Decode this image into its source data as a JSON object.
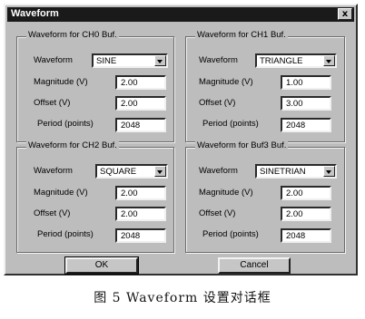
{
  "window": {
    "title": "Waveform",
    "close_label": "x"
  },
  "groups": [
    {
      "title": "Waveform for CH0 Buf.",
      "waveform_label": "Waveform",
      "waveform_value": "SINE",
      "magnitude_label": "Magnitude (V)",
      "magnitude_value": "2.00",
      "offset_label": "Offset (V)",
      "offset_value": "2.00",
      "period_label": "Period (points)",
      "period_value": "2048"
    },
    {
      "title": "Waveform for CH1 Buf.",
      "waveform_label": "Waveform",
      "waveform_value": "TRIANGLE",
      "magnitude_label": "Magnitude (V)",
      "magnitude_value": "1.00",
      "offset_label": "Offset (V)",
      "offset_value": "3.00",
      "period_label": "Period (points)",
      "period_value": "2048"
    },
    {
      "title": "Waveform for CH2 Buf.",
      "waveform_label": "Waveform",
      "waveform_value": "SQUARE",
      "magnitude_label": "Magnitude (V)",
      "magnitude_value": "2.00",
      "offset_label": "Offset (V)",
      "offset_value": "2.00",
      "period_label": "Period (points)",
      "period_value": "2048"
    },
    {
      "title": "Waveform for Buf3 Buf.",
      "waveform_label": "Waveform",
      "waveform_value": "SINETRIAN",
      "magnitude_label": "Magnitude (V)",
      "magnitude_value": "2.00",
      "offset_label": "Offset (V)",
      "offset_value": "2.00",
      "period_label": "Period (points)",
      "period_value": "2048"
    }
  ],
  "buttons": {
    "ok_label": "OK",
    "cancel_label": "Cancel"
  },
  "caption": "图 5   Waveform 设置对话框",
  "colors": {
    "dialog_bg": "#bdbdbd",
    "titlebar_bg": "#1a1a1a",
    "field_bg": "#ffffff"
  }
}
